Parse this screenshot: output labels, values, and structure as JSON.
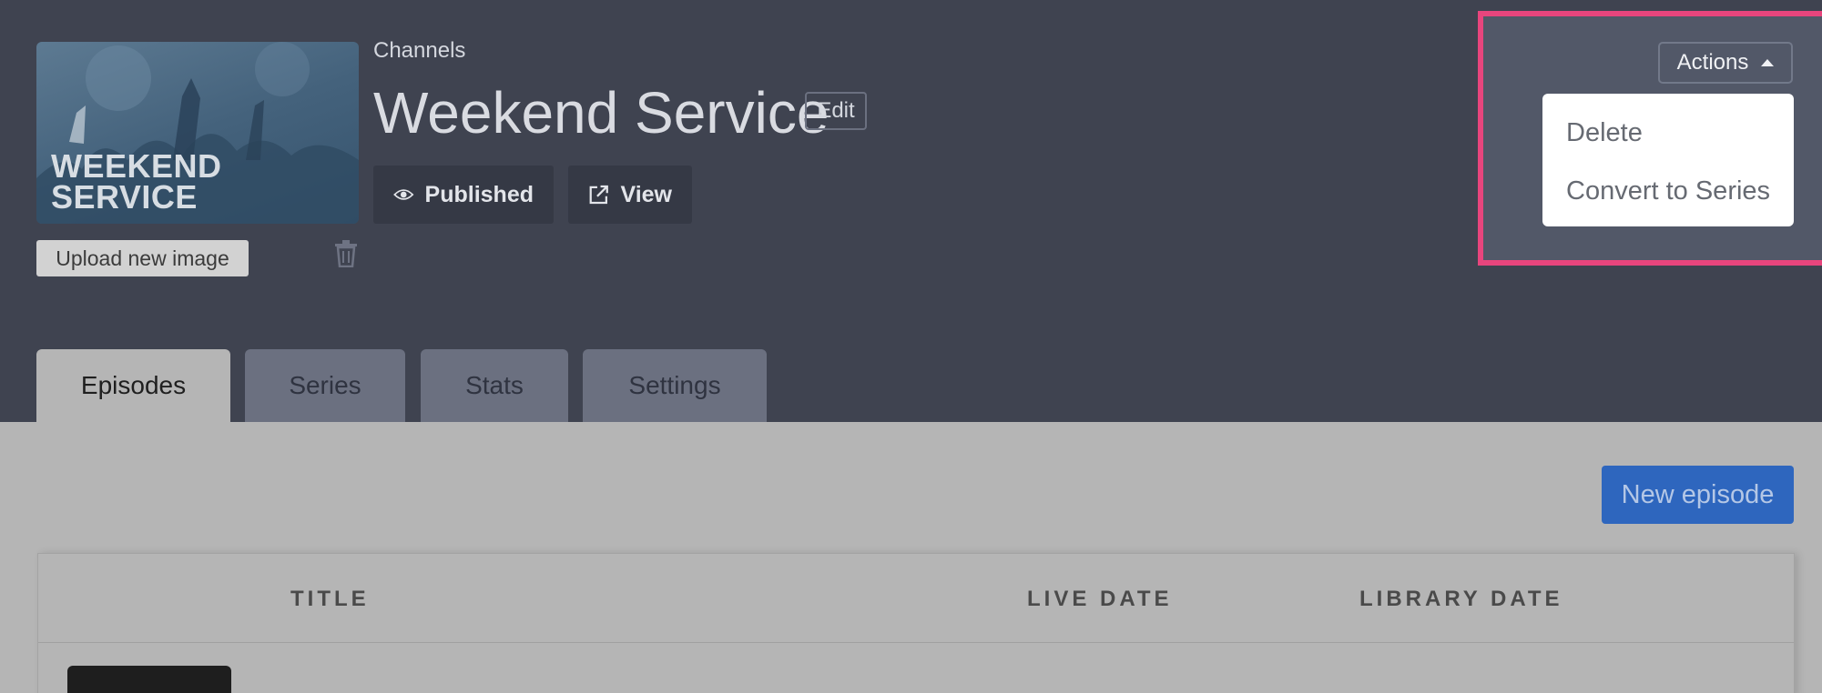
{
  "header": {
    "breadcrumb": "Channels",
    "title": "Weekend Service",
    "edit_label": "Edit",
    "thumbnail_text_line1": "WEEKEND",
    "thumbnail_text_line2": "SERVICE",
    "upload_label": "Upload new image",
    "published_label": "Published",
    "view_label": "View"
  },
  "actions": {
    "button_label": "Actions",
    "menu_items": [
      "Delete",
      "Convert to Series"
    ],
    "highlight_color": "#e8457d"
  },
  "tabs": [
    {
      "label": "Episodes",
      "active": true
    },
    {
      "label": "Series",
      "active": false
    },
    {
      "label": "Stats",
      "active": false
    },
    {
      "label": "Settings",
      "active": false
    }
  ],
  "content": {
    "new_episode_label": "New episode",
    "columns": [
      "TITLE",
      "LIVE DATE",
      "LIBRARY DATE"
    ]
  },
  "colors": {
    "header_bg": "#3f4350",
    "primary_button": "#2e66be",
    "overlay_bg": "#b5b5b5"
  }
}
